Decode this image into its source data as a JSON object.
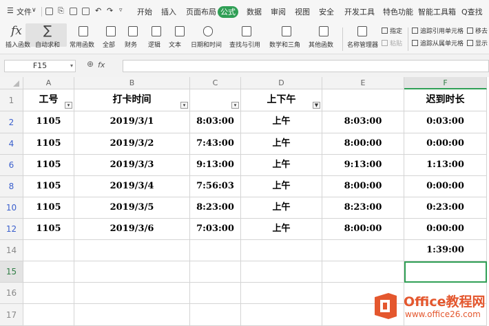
{
  "menubar": {
    "file_label": "文件",
    "tabs": [
      "开始",
      "插入",
      "页面布局",
      "公式",
      "数据",
      "审阅",
      "视图",
      "安全",
      "开发工具",
      "特色功能",
      "智能工具箱"
    ],
    "active_tab": "公式",
    "search_label": "Q查找"
  },
  "ribbon": {
    "buttons": [
      {
        "label": "插入函数",
        "icon": "fx-icon"
      },
      {
        "label": "自动求和",
        "icon": "sum-icon"
      },
      {
        "label": "常用函数",
        "icon": "function-icon"
      },
      {
        "label": "全部",
        "icon": "function-icon"
      },
      {
        "label": "财务",
        "icon": "finance-icon"
      },
      {
        "label": "逻辑",
        "icon": "logic-icon"
      },
      {
        "label": "文本",
        "icon": "text-icon"
      },
      {
        "label": "日期和时间",
        "icon": "clock-icon"
      },
      {
        "label": "查找与引用",
        "icon": "lookup-icon"
      },
      {
        "label": "数学和三角",
        "icon": "math-icon"
      },
      {
        "label": "其他函数",
        "icon": "more-icon"
      },
      {
        "label": "名称管理器",
        "icon": "name-manager-icon"
      }
    ],
    "small_items": {
      "specify": "指定",
      "paste": "粘贴",
      "trace_precedents": "追踪引用单元格",
      "trace_dependents": "追踪从属单元格",
      "remove": "移去",
      "show": "显示"
    }
  },
  "formula_bar": {
    "name_box": "F15",
    "fx_label": "fx",
    "formula": ""
  },
  "sheet": {
    "columns": [
      "A",
      "B",
      "C",
      "D",
      "E",
      "F"
    ],
    "selected_column": "F",
    "header_row": {
      "row_num": "1",
      "cells": [
        "工号",
        "打卡时间",
        "",
        "上下午",
        "",
        "迟到时长"
      ]
    },
    "rows": [
      {
        "row_num": "2",
        "cells": [
          "1105",
          "2019/3/1",
          "8:03:00",
          "上午",
          "8:03:00",
          "0:03:00"
        ]
      },
      {
        "row_num": "4",
        "cells": [
          "1105",
          "2019/3/2",
          "7:43:00",
          "上午",
          "8:00:00",
          "0:00:00"
        ]
      },
      {
        "row_num": "6",
        "cells": [
          "1105",
          "2019/3/3",
          "9:13:00",
          "上午",
          "9:13:00",
          "1:13:00"
        ]
      },
      {
        "row_num": "8",
        "cells": [
          "1105",
          "2019/3/4",
          "7:56:03",
          "上午",
          "8:00:00",
          "0:00:00"
        ]
      },
      {
        "row_num": "10",
        "cells": [
          "1105",
          "2019/3/5",
          "8:23:00",
          "上午",
          "8:23:00",
          "0:23:00"
        ]
      },
      {
        "row_num": "12",
        "cells": [
          "1105",
          "2019/3/6",
          "7:03:00",
          "上午",
          "8:00:00",
          "0:00:00"
        ]
      },
      {
        "row_num": "14",
        "cells": [
          "",
          "",
          "",
          "",
          "",
          "1:39:00"
        ]
      },
      {
        "row_num": "15",
        "cells": [
          "",
          "",
          "",
          "",
          "",
          ""
        ]
      },
      {
        "row_num": "16",
        "cells": [
          "",
          "",
          "",
          "",
          "",
          ""
        ]
      },
      {
        "row_num": "17",
        "cells": [
          "",
          "",
          "",
          "",
          "",
          ""
        ]
      }
    ],
    "selected_cell": "F15"
  },
  "watermark": {
    "title": "Office教程网",
    "url": "www.office26.com"
  }
}
